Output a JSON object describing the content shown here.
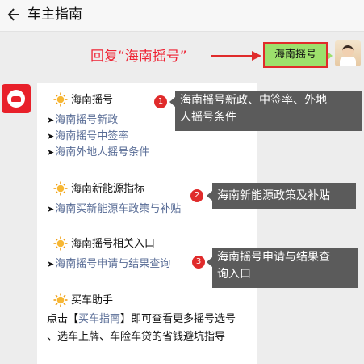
{
  "header": {
    "title": "车主指南"
  },
  "annotation": {
    "hint": "回复“海南摇号”"
  },
  "message": {
    "text": "海南摇号"
  },
  "card": {
    "sections": [
      {
        "title": "海南摇号",
        "links": [
          "海南摇号新政",
          "海南摇号中签率",
          "海南外地人摇号条件"
        ]
      },
      {
        "title": "海南新能源指标",
        "links": [
          "海南买新能源车政策与补贴"
        ]
      },
      {
        "title": "海南摇号相关入口",
        "links": [
          "海南摇号申请与结果查询"
        ]
      },
      {
        "title": "买车助手",
        "body_prefix": "点击【",
        "body_link": "买车指南",
        "body_suffix": "】即可查看更多摇号选号",
        "body_line2": "、选车上牌、车险车贷的省钱避坑指导"
      }
    ]
  },
  "callouts": [
    {
      "num": "1",
      "lines": [
        "海南摇号新政、中签率、外地",
        "人摇号条件"
      ]
    },
    {
      "num": "2",
      "lines": [
        "海南新能源政策及补贴"
      ]
    },
    {
      "num": "3",
      "lines": [
        "海南摇号申请与结果查",
        "询入口"
      ]
    }
  ],
  "colors": {
    "accent_red": "#e02b2b",
    "bubble_green": "#9de06c",
    "link_blue": "#576b95",
    "callout_gray": "#5b5b5b"
  }
}
